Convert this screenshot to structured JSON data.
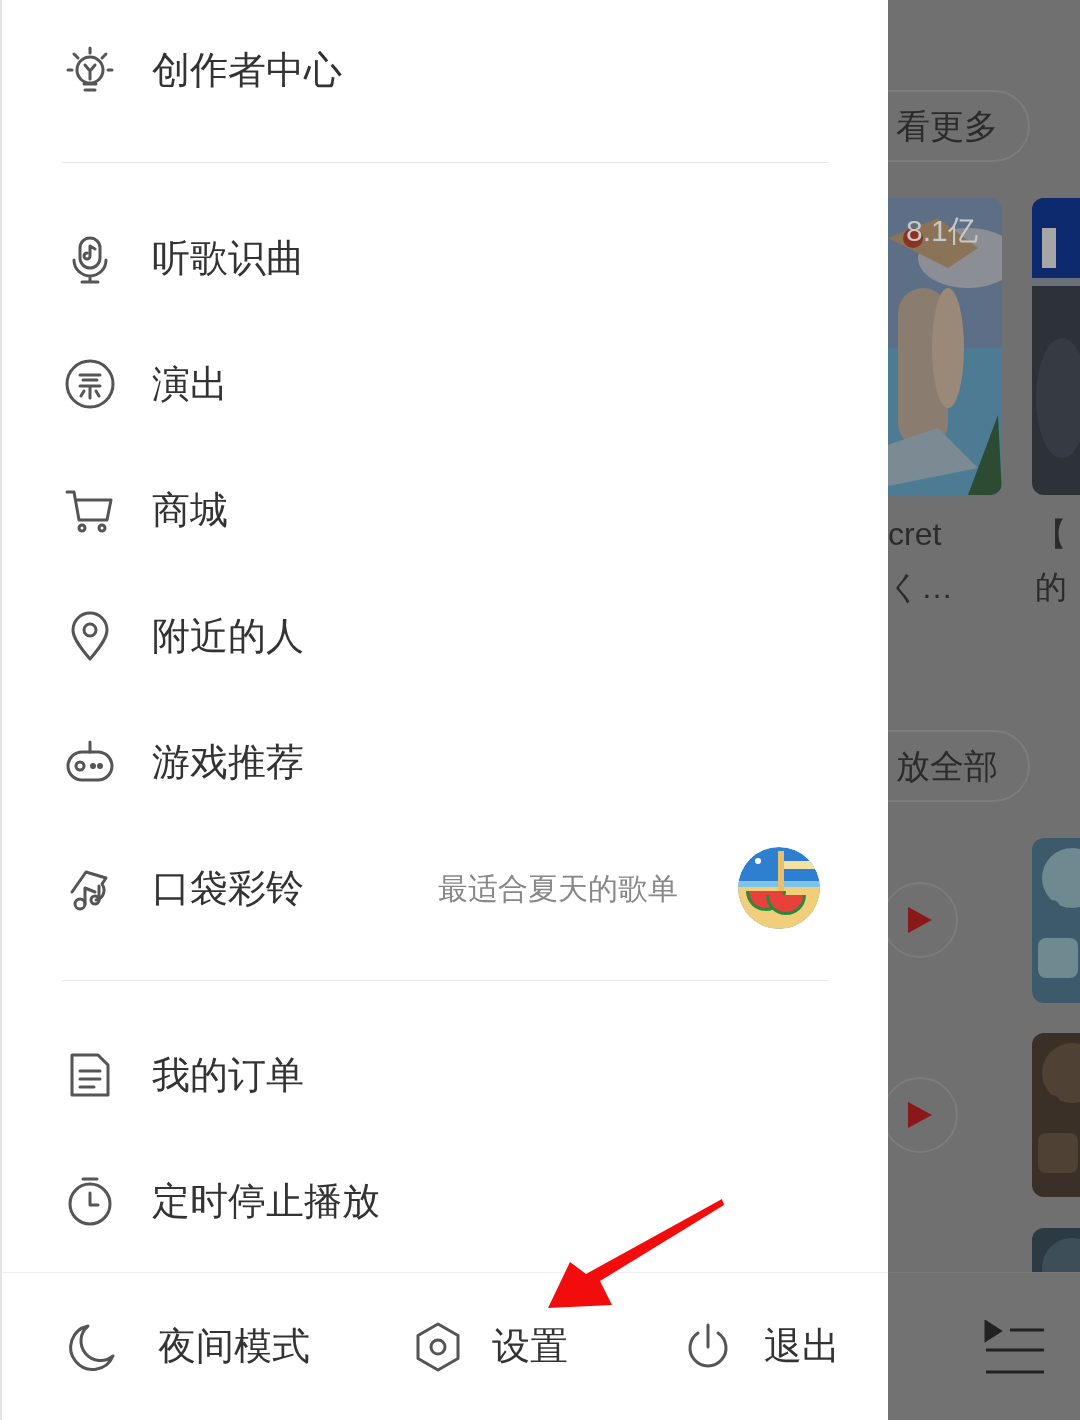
{
  "drawer": {
    "top_item": {
      "label": "创作者中心"
    },
    "groups": [
      {
        "items": [
          {
            "label": "听歌识曲"
          },
          {
            "label": "演出"
          },
          {
            "label": "商城"
          },
          {
            "label": "附近的人"
          },
          {
            "label": "游戏推荐"
          },
          {
            "label": "口袋彩铃",
            "subtitle": "最适合夏天的歌单"
          }
        ]
      },
      {
        "items": [
          {
            "label": "我的订单"
          },
          {
            "label": "定时停止播放"
          }
        ]
      }
    ],
    "bottom_actions": [
      {
        "label": "夜间模式"
      },
      {
        "label": "设置"
      },
      {
        "label": "退出"
      }
    ]
  },
  "background": {
    "more_button": "看更多",
    "play_count": "8.1亿",
    "cards": [
      {
        "line_1": "cret",
        "line_2": "く…"
      },
      {
        "line_1": "【",
        "line_2": "的"
      }
    ],
    "play_all_button": "放全部"
  }
}
